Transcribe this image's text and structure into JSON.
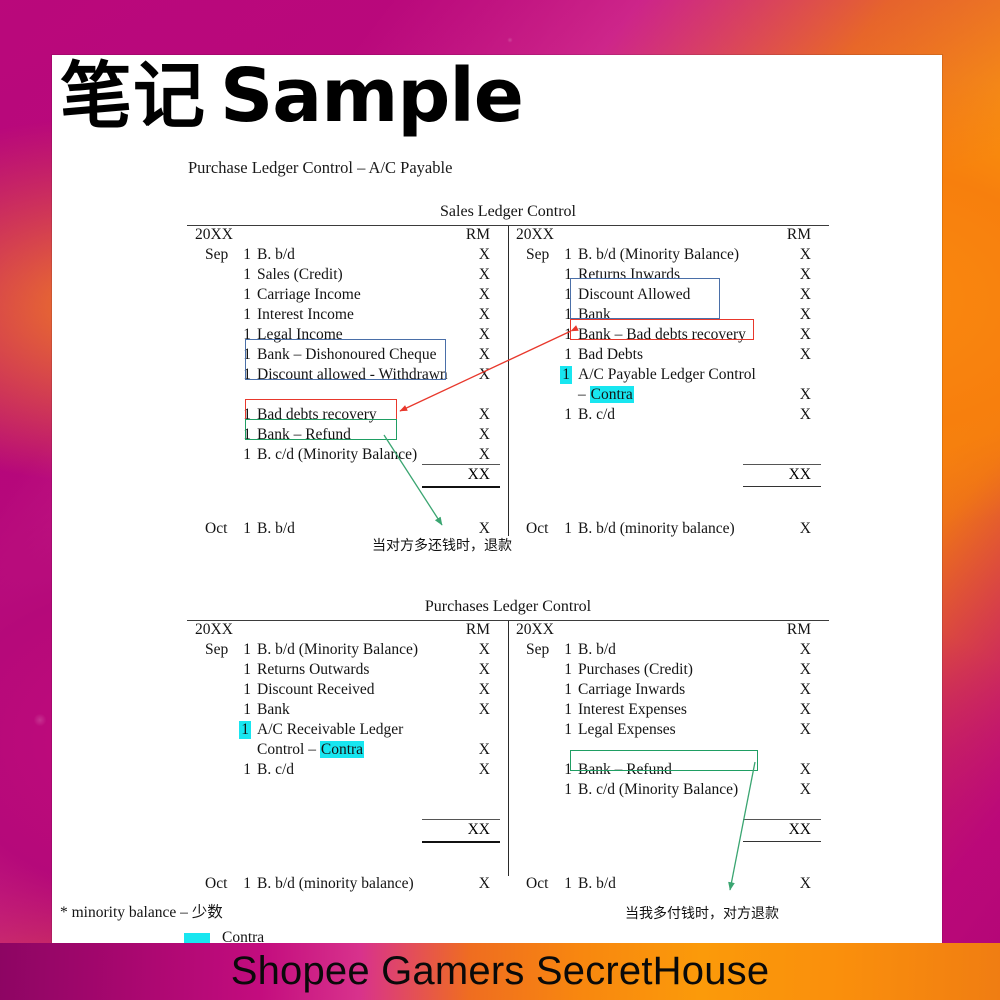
{
  "heading": {
    "cn": "笔记",
    "en": "Sample"
  },
  "subtitle": "Purchase Ledger Control – A/C Payable",
  "ledgers": [
    {
      "id": "sales-ledger-control",
      "title": "Sales Ledger Control",
      "left": {
        "year": "20XX",
        "currency": "RM",
        "rows": [
          {
            "month": "Sep",
            "day": "1",
            "desc": "B. b/d",
            "amt": "X"
          },
          {
            "month": "",
            "day": "1",
            "desc": "Sales (Credit)",
            "amt": "X"
          },
          {
            "month": "",
            "day": "1",
            "desc": "Carriage Income",
            "amt": "X"
          },
          {
            "month": "",
            "day": "1",
            "desc": "Interest Income",
            "amt": "X"
          },
          {
            "month": "",
            "day": "1",
            "desc": "Legal Income",
            "amt": "X"
          },
          {
            "month": "",
            "day": "1",
            "desc": "Bank – Dishonoured Cheque",
            "amt": "X"
          },
          {
            "month": "",
            "day": "1",
            "desc": "Discount allowed - Withdrawn",
            "amt": "X"
          },
          {
            "month": "",
            "day": "",
            "desc": "",
            "amt": ""
          },
          {
            "month": "",
            "day": "1",
            "desc": "Bad debts recovery",
            "amt": "X"
          },
          {
            "month": "",
            "day": "1",
            "desc": "Bank – Refund",
            "amt": "X"
          },
          {
            "month": "",
            "day": "1",
            "desc": "B. c/d (Minority Balance)",
            "amt": "X"
          }
        ],
        "total": "XX",
        "carry": {
          "month": "Oct",
          "day": "1",
          "desc": "B. b/d",
          "amt": "X"
        }
      },
      "right": {
        "year": "20XX",
        "currency": "RM",
        "rows": [
          {
            "month": "Sep",
            "day": "1",
            "desc": "B. b/d (Minority Balance)",
            "amt": "X"
          },
          {
            "month": "",
            "day": "1",
            "desc": "Returns Inwards",
            "amt": "X"
          },
          {
            "month": "",
            "day": "1",
            "desc": "Discount Allowed",
            "amt": "X"
          },
          {
            "month": "",
            "day": "1",
            "desc": "Bank",
            "amt": "X"
          },
          {
            "month": "",
            "day": "1",
            "desc": "Bank – Bad debts recovery",
            "amt": "X"
          },
          {
            "month": "",
            "day": "1",
            "desc": "Bad Debts",
            "amt": "X"
          },
          {
            "month": "",
            "day": "1",
            "day_highlight": true,
            "desc": "A/C Payable Ledger Control",
            "amt": ""
          },
          {
            "month": "",
            "day": "",
            "desc": "– Contra",
            "desc_highlight": "Contra",
            "amt": "X"
          },
          {
            "month": "",
            "day": "1",
            "desc": "B. c/d",
            "amt": "X"
          }
        ],
        "total": "XX",
        "carry": {
          "month": "Oct",
          "day": "1",
          "desc": "B. b/d (minority balance)",
          "amt": "X"
        }
      }
    },
    {
      "id": "purchases-ledger-control",
      "title": "Purchases Ledger Control",
      "left": {
        "year": "20XX",
        "currency": "RM",
        "rows": [
          {
            "month": "Sep",
            "day": "1",
            "desc": "B. b/d (Minority Balance)",
            "amt": "X"
          },
          {
            "month": "",
            "day": "1",
            "desc": "Returns Outwards",
            "amt": "X"
          },
          {
            "month": "",
            "day": "1",
            "desc": "Discount Received",
            "amt": "X"
          },
          {
            "month": "",
            "day": "1",
            "desc": "Bank",
            "amt": "X"
          },
          {
            "month": "",
            "day": "1",
            "day_highlight": true,
            "desc": "A/C Receivable Ledger",
            "amt": ""
          },
          {
            "month": "",
            "day": "",
            "desc": "Control – Contra",
            "desc_highlight": "Contra",
            "amt": "X"
          },
          {
            "month": "",
            "day": "1",
            "desc": "B. c/d",
            "amt": "X"
          }
        ],
        "total": "XX",
        "carry": {
          "month": "Oct",
          "day": "1",
          "desc": "B. b/d (minority balance)",
          "amt": "X"
        }
      },
      "right": {
        "year": "20XX",
        "currency": "RM",
        "rows": [
          {
            "month": "Sep",
            "day": "1",
            "desc": "B. b/d",
            "amt": "X"
          },
          {
            "month": "",
            "day": "1",
            "desc": "Purchases (Credit)",
            "amt": "X"
          },
          {
            "month": "",
            "day": "1",
            "desc": "Carriage Inwards",
            "amt": "X"
          },
          {
            "month": "",
            "day": "1",
            "desc": "Interest Expenses",
            "amt": "X"
          },
          {
            "month": "",
            "day": "1",
            "desc": "Legal Expenses",
            "amt": "X"
          },
          {
            "month": "",
            "day": "",
            "desc": "",
            "amt": ""
          },
          {
            "month": "",
            "day": "1",
            "desc": "Bank – Refund",
            "amt": "X"
          },
          {
            "month": "",
            "day": "1",
            "desc": "B. c/d (Minority Balance)",
            "amt": "X"
          }
        ],
        "total": "XX",
        "carry": {
          "month": "Oct",
          "day": "1",
          "desc": "B. b/d",
          "amt": "X"
        }
      }
    }
  ],
  "annotations": {
    "note_refund_sales": "当对方多还钱时，退款",
    "note_refund_purchases": "当我多付钱时，对方退款"
  },
  "footnotes": {
    "minority": "* minority balance – 少数",
    "legend_label": "Contra"
  },
  "colors": {
    "blue_box": "#4a6fa8",
    "red_box": "#e8382c",
    "green_box": "#1f9e63",
    "highlight_cyan": "#18e6f0",
    "banner_magenta": "#c30c7e",
    "banner_orange": "#fb9a0a"
  },
  "banner": {
    "text": "Shopee Gamers SecretHouse"
  }
}
